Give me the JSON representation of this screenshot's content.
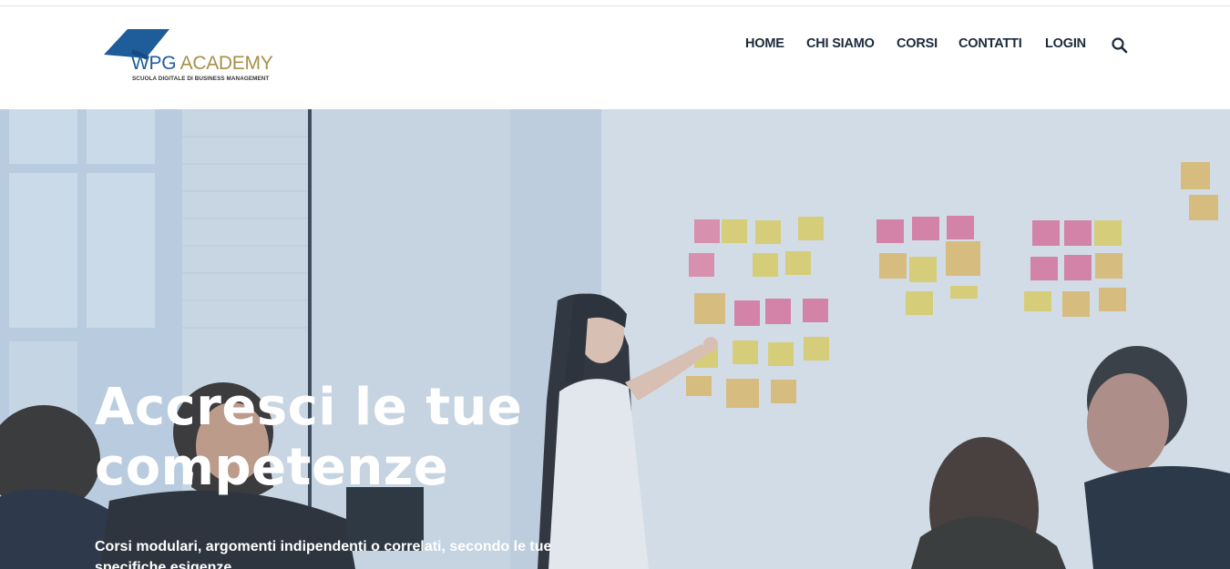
{
  "brand": {
    "name_part1": "WPG",
    "name_part2": "ACADEMY",
    "tagline": "SCUOLA DIGITALE DI BUSINESS MANAGEMENT",
    "colors": {
      "blue": "#1e5c9a",
      "gold": "#a8904a"
    }
  },
  "nav": {
    "items": [
      {
        "label": "HOME"
      },
      {
        "label": "CHI SIAMO"
      },
      {
        "label": "CORSI"
      },
      {
        "label": "CONTATTI"
      },
      {
        "label": "LOGIN"
      }
    ],
    "search_icon": "search-icon"
  },
  "hero": {
    "title": "Accresci le tue competenze",
    "subtitle": "Corsi modulari, argomenti indipendenti o correlati, secondo le tue specifiche esigenze"
  }
}
